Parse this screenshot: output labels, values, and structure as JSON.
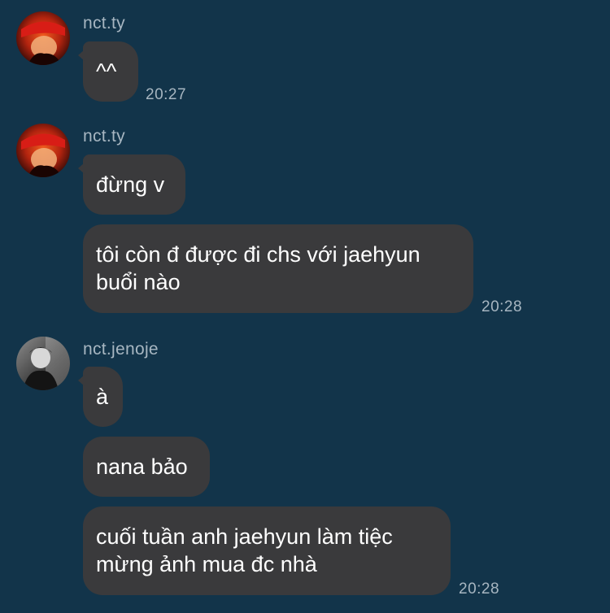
{
  "colors": {
    "background": "#12344a",
    "bubble": "#3a3a3c",
    "meta_text": "#a7b6c1",
    "message_text": "#ffffff"
  },
  "groups": [
    {
      "sender": "nct.ty",
      "avatar_icon": "profile-photo-icon",
      "messages": [
        "^^"
      ],
      "time": "20:27"
    },
    {
      "sender": "nct.ty",
      "avatar_icon": "profile-photo-icon",
      "messages": [
        "đừng v",
        "tôi còn đ được đi chs với jaehyun buổi nào"
      ],
      "time": "20:28"
    },
    {
      "sender": "nct.jenoje",
      "avatar_icon": "profile-photo-icon",
      "messages": [
        "à",
        "nana bảo",
        "cuối tuần anh jaehyun làm tiệc mừng ảnh mua đc nhà"
      ],
      "time": "20:28"
    }
  ]
}
